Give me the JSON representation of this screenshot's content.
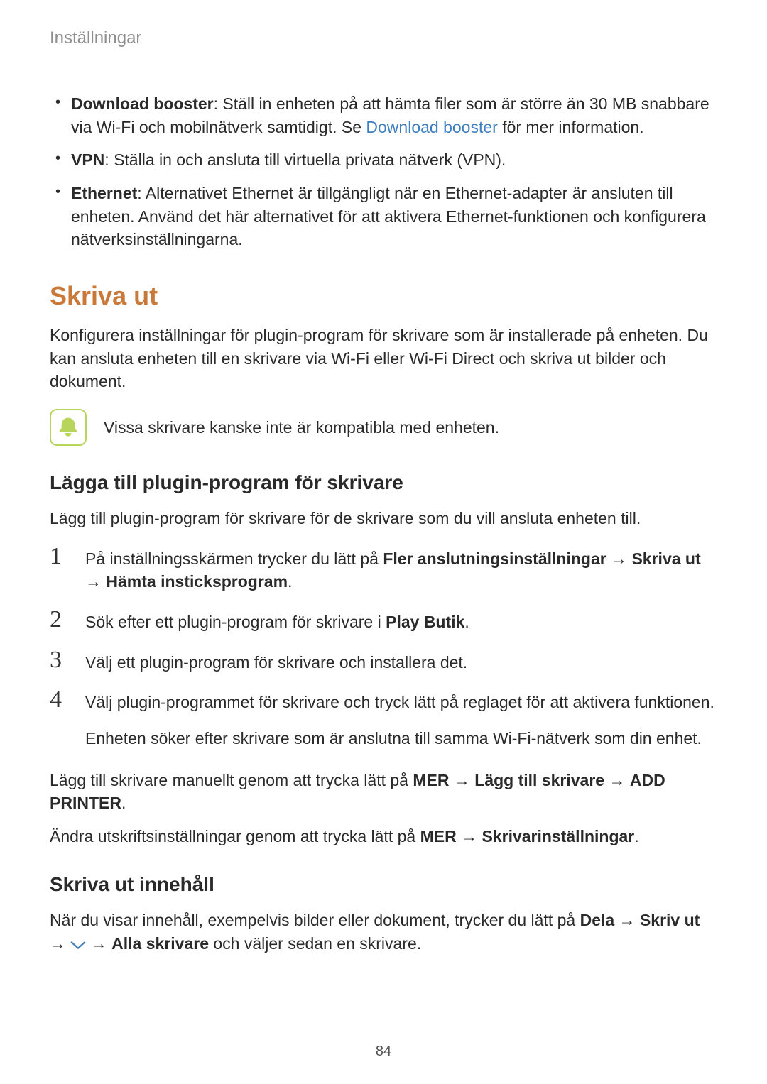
{
  "header": {
    "title": "Inställningar"
  },
  "bullets": {
    "b1": {
      "term": "Download booster",
      "text_a": ": Ställ in enheten på att hämta filer som är större än 30 MB snabbare via Wi-Fi och mobilnätverk samtidigt. Se ",
      "link": "Download booster",
      "text_b": " för mer information."
    },
    "b2": {
      "term": "VPN",
      "text": ": Ställa in och ansluta till virtuella privata nätverk (VPN)."
    },
    "b3": {
      "term": "Ethernet",
      "text": ": Alternativet Ethernet är tillgängligt när en Ethernet-adapter är ansluten till enheten. Använd det här alternativet för att aktivera Ethernet-funktionen och konfigurera nätverksinställningarna."
    }
  },
  "section": {
    "title": "Skriva ut",
    "intro": "Konfigurera inställningar för plugin-program för skrivare som är installerade på enheten. Du kan ansluta enheten till en skrivare via Wi-Fi eller Wi-Fi Direct och skriva ut bilder och dokument."
  },
  "note": {
    "text": "Vissa skrivare kanske inte är kompatibla med enheten."
  },
  "sub1": {
    "title": "Lägga till plugin-program för skrivare",
    "intro": "Lägg till plugin-program för skrivare för de skrivare som du vill ansluta enheten till."
  },
  "steps": {
    "s1": {
      "num": "1",
      "pre": "På inställningsskärmen trycker du lätt på ",
      "b1": "Fler anslutningsinställningar",
      "arr1": " → ",
      "b2": "Skriva ut",
      "arr2": " → ",
      "b3": "Hämta insticksprogram",
      "post": "."
    },
    "s2": {
      "num": "2",
      "pre": "Sök efter ett plugin-program för skrivare i ",
      "b1": "Play Butik",
      "post": "."
    },
    "s3": {
      "num": "3",
      "text": "Välj ett plugin-program för skrivare och installera det."
    },
    "s4": {
      "num": "4",
      "text": "Välj plugin-programmet för skrivare och tryck lätt på reglaget för att aktivera funktionen.",
      "follow": "Enheten söker efter skrivare som är anslutna till samma Wi-Fi-nätverk som din enhet."
    }
  },
  "after": {
    "p1": {
      "pre": "Lägg till skrivare manuellt genom att trycka lätt på ",
      "b1": "MER",
      "arr1": " → ",
      "b2": "Lägg till skrivare",
      "arr2": " → ",
      "b3": "ADD PRINTER",
      "post": "."
    },
    "p2": {
      "pre": "Ändra utskriftsinställningar genom att trycka lätt på ",
      "b1": "MER",
      "arr1": " → ",
      "b2": "Skrivarinställningar",
      "post": "."
    }
  },
  "sub2": {
    "title": "Skriva ut innehåll",
    "p": {
      "pre": "När du visar innehåll, exempelvis bilder eller dokument, trycker du lätt på ",
      "b1": "Dela",
      "arr1": " → ",
      "b2": "Skriv ut",
      "arr2": " → ",
      "arr3": " → ",
      "b3": "Alla skrivare",
      "post": " och väljer sedan en skrivare."
    }
  },
  "page_number": "84"
}
